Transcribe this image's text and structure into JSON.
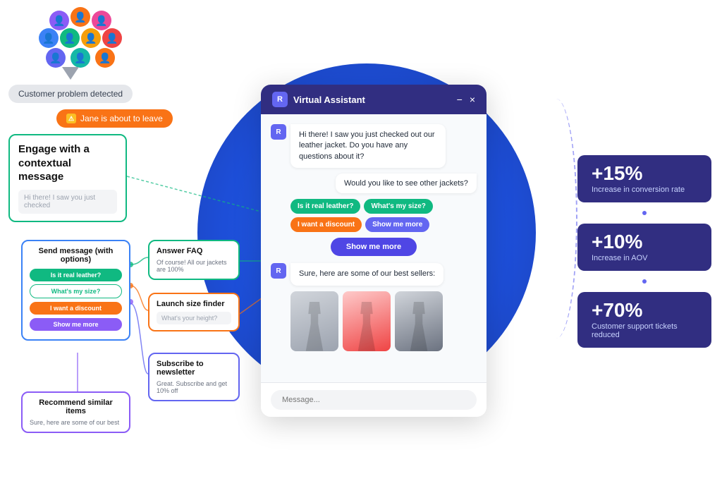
{
  "people": {
    "colors": [
      "#f97316",
      "#8b5cf6",
      "#ec4899",
      "#3b82f6",
      "#10b981",
      "#f59e0b",
      "#ef4444",
      "#6366f1",
      "#14b8a6",
      "#f97316"
    ]
  },
  "badges": {
    "customer_problem": "Customer problem detected",
    "jane_leaving": "Jane is about to leave"
  },
  "engage_box": {
    "title": "Engage with a contextual message",
    "placeholder": "Hi there! I saw you just checked"
  },
  "send_msg_box": {
    "title": "Send message (with options)",
    "btn1": "Is it real leather?",
    "btn2": "What's my size?",
    "btn3": "I want a discount",
    "btn4": "Show me more"
  },
  "faq_box": {
    "title": "Answer FAQ",
    "text": "Of course! All our jackets are 100%"
  },
  "size_finder_box": {
    "title": "Launch size finder",
    "placeholder": "What's your height?"
  },
  "subscribe_box": {
    "title": "Subscribe to newsletter",
    "text": "Great. Subscribe and get 10% off"
  },
  "recommend_box": {
    "title": "Recommend similar items",
    "text": "Sure, here are some of our best"
  },
  "chat": {
    "title": "Virtual Assistant",
    "logo": "R",
    "minimize": "−",
    "close": "×",
    "msg1": "Hi there! I saw you just checked out our leather jacket. Do you have any questions about it?",
    "msg2": "Would you like to see other jackets?",
    "btn1": "Is it real leather?",
    "btn2": "What's my size?",
    "btn3": "I want a discount",
    "btn4": "Show me more",
    "show_more": "Show me more",
    "bot_response": "Sure, here are some of our best sellers:",
    "message_placeholder": "Message..."
  },
  "stats": [
    {
      "number": "+15%",
      "desc": "Increase in conversion rate"
    },
    {
      "number": "+10%",
      "desc": "Increase in AOV"
    },
    {
      "number": "+70%",
      "desc": "Customer support tickets reduced"
    }
  ]
}
